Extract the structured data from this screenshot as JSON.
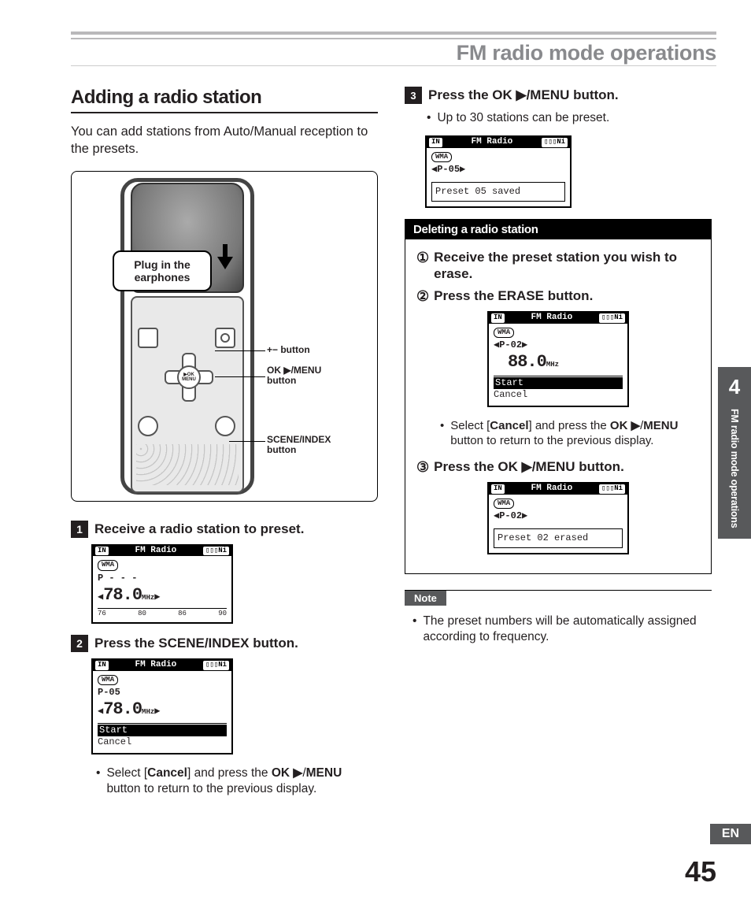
{
  "chapter_title": "FM radio mode operations",
  "section_title": "Adding a radio station",
  "intro": "You can add stations from Auto/Manual reception to the presets.",
  "diagram": {
    "callout": "Plug in the earphones",
    "label_plusminus": "+− button",
    "label_okmenu": "OK ▶/MENU button",
    "label_scene": "SCENE/INDEX button",
    "dpad_center": "▶OK MENU"
  },
  "steps": {
    "s1": "Receive a radio station to preset.",
    "s2_a": "Press the ",
    "s2_b": "SCENE/INDEX",
    "s2_c": " button.",
    "s2_note_a": "Select [",
    "s2_note_b": "Cancel",
    "s2_note_c": "] and press the ",
    "s2_note_d": "OK ▶",
    "s2_note_e": "/",
    "s2_note_f": "MENU",
    "s2_note_g": " button to return to the previous display.",
    "s3_a": "Press the ",
    "s3_b": "OK ▶/MENU",
    "s3_c": " button.",
    "s3_note": "Up to 30 stations can be preset."
  },
  "lcd_common": {
    "title": "FM Radio",
    "in": "IN",
    "bat": "▯▯▯Ni",
    "wma": "WMA"
  },
  "lcd1": {
    "preset": "P - - -",
    "freq": "78.0",
    "unit": "MHz",
    "scale": [
      "76",
      "80",
      "86",
      "90"
    ]
  },
  "lcd2": {
    "preset": "P-05",
    "freq": "78.0",
    "unit": "MHz",
    "opt_sel": "Start",
    "opt2": "Cancel"
  },
  "lcd3": {
    "preset": "◀P-05▶",
    "msg": "Preset 05 saved"
  },
  "deleting": {
    "title": "Deleting a radio station",
    "d1": "Receive the preset station you wish to erase.",
    "d2_a": "Press the ",
    "d2_b": "ERASE",
    "d2_c": " button.",
    "lcdA": {
      "preset": "◀P-02▶",
      "freq": "88.0",
      "unit": "MHz",
      "opt_sel": "Start",
      "opt2": "Cancel"
    },
    "note_a": "Select [",
    "note_b": "Cancel",
    "note_c": "] and press the ",
    "note_d": "OK ▶",
    "note_e": "/",
    "note_f": "MENU",
    "note_g": " button to return to the previous display.",
    "d3_a": "Press the ",
    "d3_b": "OK ▶/MENU",
    "d3_c": " button.",
    "lcdB": {
      "preset": "◀P-02▶",
      "msg": "Preset 02 erased"
    }
  },
  "note": {
    "label": "Note",
    "text": "The preset numbers will be automatically assigned according to frequency."
  },
  "side": {
    "chapter": "4",
    "label": "FM radio mode operations"
  },
  "lang": "EN",
  "page": "45"
}
